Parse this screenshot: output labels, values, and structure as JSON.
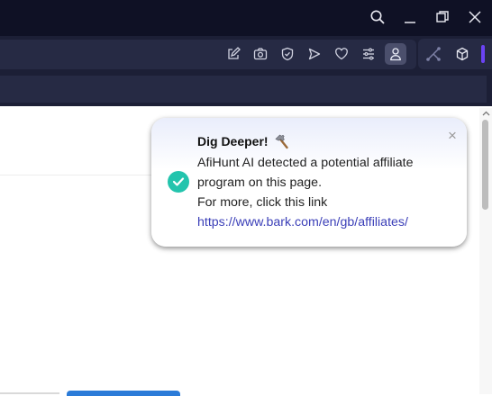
{
  "window_controls": {
    "icons": [
      "search-icon",
      "minimize-icon",
      "restore-icon",
      "close-icon"
    ]
  },
  "toolbar": {
    "icons": [
      "edit-icon",
      "camera-icon",
      "shield-icon",
      "send-icon",
      "heart-icon",
      "menu-icon",
      "profile-icon",
      "graph-icon",
      "cube-icon"
    ],
    "accent_color": "#6b43f5"
  },
  "toast": {
    "title": "Dig Deeper!",
    "title_icon": "hammer-icon",
    "line1": "AfiHunt AI detected a potential affiliate",
    "line2": "program on this page.",
    "line3": "For more, click this link",
    "link": "https://www.bark.com/en/gb/affiliates/",
    "close": "×",
    "status_icon": "check-circle-icon",
    "status_color": "#23c4ad"
  }
}
